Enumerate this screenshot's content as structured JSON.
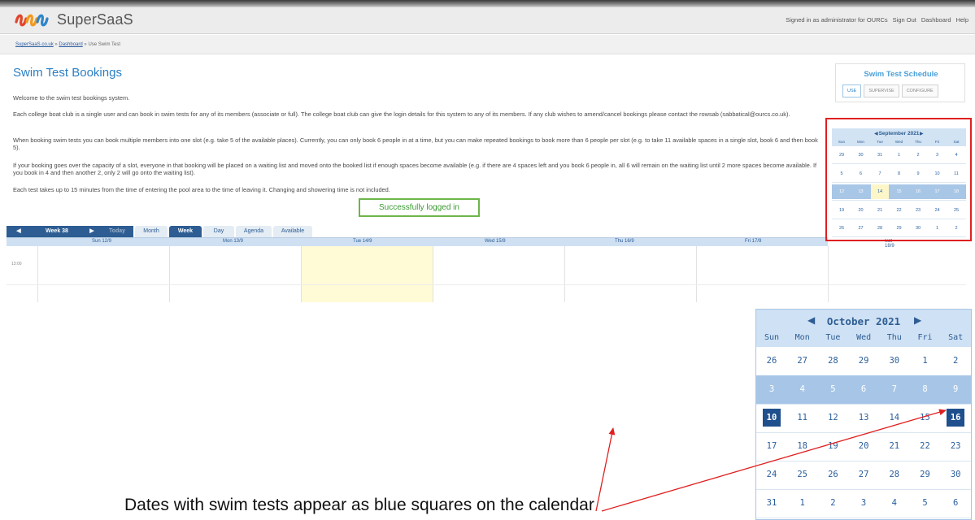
{
  "header": {
    "brand": "SuperSaaS",
    "signed_in": "Signed in as administrator for OURCs",
    "links": [
      "Sign Out",
      "Dashboard",
      "Help"
    ]
  },
  "breadcrumb": {
    "site": "SuperSaaS.co.uk",
    "sep1": "»",
    "dashboard": "Dashboard",
    "sep2": "»",
    "current": "Use Swim Test"
  },
  "main": {
    "title": "Swim Test Bookings",
    "paragraphs": [
      "Welcome to the swim test bookings system.",
      "Each college boat club is a single user and can book in swim tests for any of its members (associate or full).  The college boat club can give the login details for this system to any of its members. If any club wishes to amend/cancel bookings please contact the rowsab (sabbatical@ourcs.co.uk).",
      "When booking swim tests you can book multiple members into one slot (e.g. take 5 of the available places). Currently, you can only book 6 people in at a time, but you can make repeated bookings to book more than 6 people per slot (e.g. to take 11 available spaces in a single slot, book 6 and then book 5).",
      "If your booking goes over the capacity of a slot, everyone in that booking will be placed on a waiting list and moved onto the booked list if enough spaces become available (e.g. if there are 4 spaces left and you book 6 people in, all 6 will remain on the waiting list until 2 more spaces become available. If you book in 4 and then another 2, only 2 will go onto the waiting list).",
      "Each test takes up to 15 minutes from the time of entering the pool area to the time of leaving it.  Changing and showering time is not included."
    ],
    "login_message": "Successfully logged in"
  },
  "schedule_panel": {
    "title": "Swim Test Schedule",
    "tabs": [
      "USE",
      "SUPERVISE",
      "CONFIGURE"
    ],
    "active_tab": "USE"
  },
  "week_view": {
    "week_label": "Week 38",
    "today": "Today",
    "tabs": [
      "Month",
      "Week",
      "Day",
      "Agenda",
      "Available"
    ],
    "active_tab": "Week",
    "days": [
      "Sun 12/9",
      "Mon 13/9",
      "Tue 14/9",
      "Wed 15/9",
      "Thu 16/9",
      "Fri 17/9",
      "Sat 18/9"
    ],
    "first_time": "13:00"
  },
  "mini_calendar_september": {
    "title": "September 2021",
    "dow": [
      "Sun",
      "Mon",
      "Tue",
      "Wed",
      "Thu",
      "Fri",
      "Sat"
    ],
    "weeks": [
      [
        "29",
        "30",
        "31",
        "1",
        "2",
        "3",
        "4"
      ],
      [
        "5",
        "6",
        "7",
        "8",
        "9",
        "10",
        "11"
      ],
      [
        "12",
        "13",
        "14",
        "15",
        "16",
        "17",
        "18"
      ],
      [
        "19",
        "20",
        "21",
        "22",
        "23",
        "24",
        "25"
      ],
      [
        "26",
        "27",
        "28",
        "29",
        "30",
        "1",
        "2"
      ]
    ],
    "selected_week_index": 2,
    "today": "14"
  },
  "mini_calendar_october": {
    "title": "October 2021",
    "dow": [
      "Sun",
      "Mon",
      "Tue",
      "Wed",
      "Thu",
      "Fri",
      "Sat"
    ],
    "weeks": [
      [
        "26",
        "27",
        "28",
        "29",
        "30",
        "1",
        "2"
      ],
      [
        "3",
        "4",
        "5",
        "6",
        "7",
        "8",
        "9"
      ],
      [
        "10",
        "11",
        "12",
        "13",
        "14",
        "15",
        "16"
      ],
      [
        "17",
        "18",
        "19",
        "20",
        "21",
        "22",
        "23"
      ],
      [
        "24",
        "25",
        "26",
        "27",
        "28",
        "29",
        "30"
      ],
      [
        "31",
        "1",
        "2",
        "3",
        "4",
        "5",
        "6"
      ]
    ],
    "selected_week_index": 1,
    "event_days": [
      "10",
      "16"
    ]
  },
  "annotation": {
    "text": "Dates with swim tests appear as blue squares on the calendar",
    "color": "#e02020"
  },
  "colors": {
    "brand_blue": "#2b7fc4",
    "calendar_dark": "#2d5d93",
    "success_green": "#6db54a",
    "highlight_red": "#e02020"
  }
}
